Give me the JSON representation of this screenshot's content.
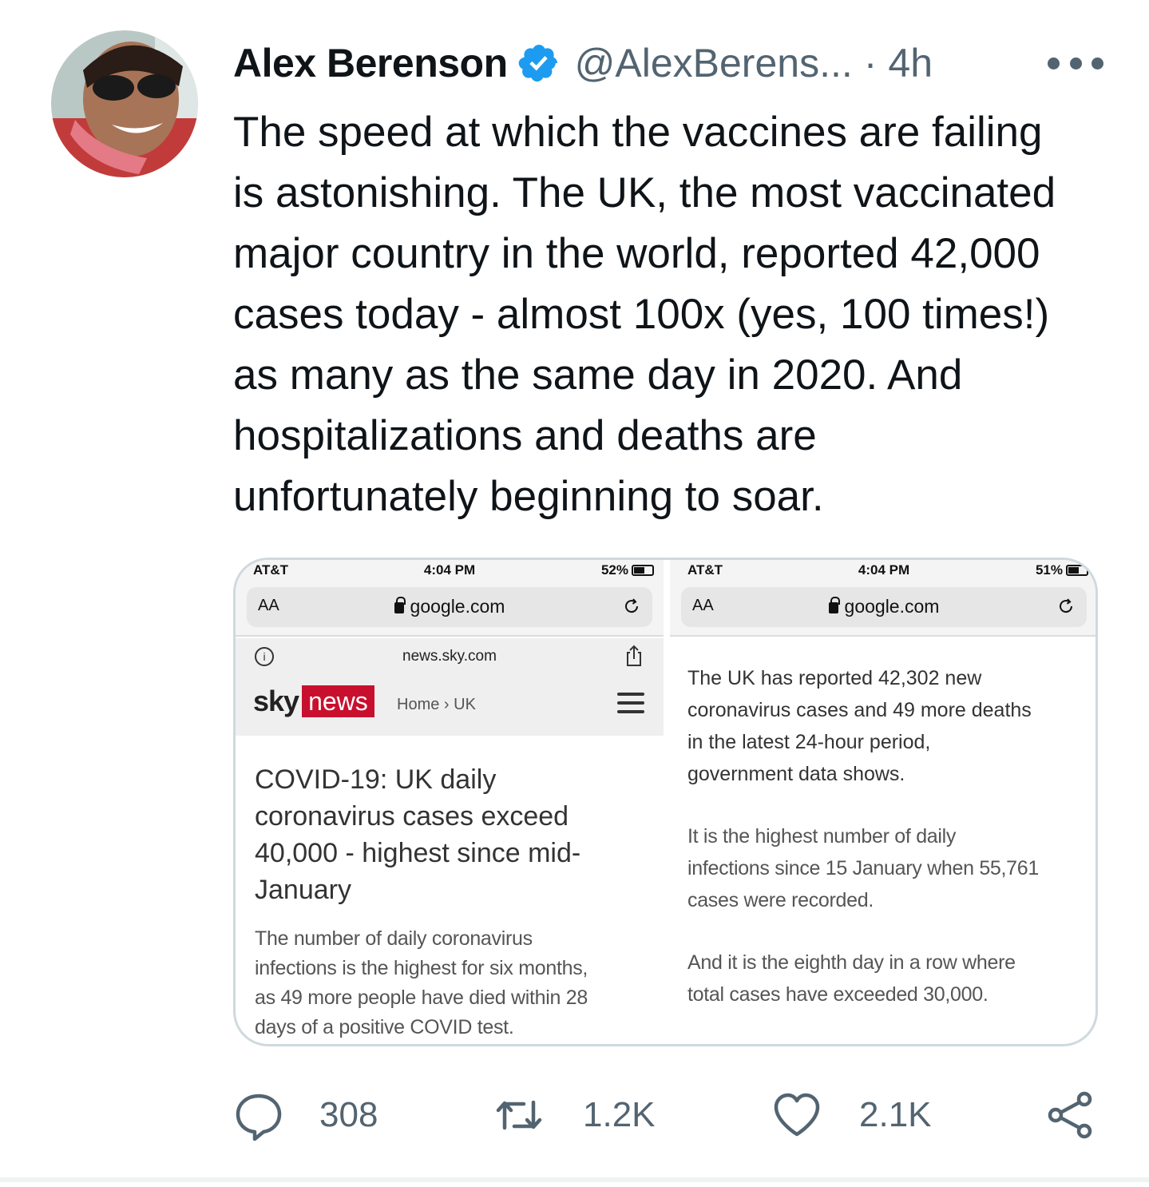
{
  "tweet": {
    "author_name": "Alex Berenson",
    "handle": "@AlexBerens...",
    "separator": "·",
    "time": "4h",
    "text_lines": [
      "The speed at which the vaccines are failing",
      "is astonishing. The UK, the most vaccinated",
      "major country in the world, reported 42,000",
      "cases today - almost 100x (yes, 100 times!)",
      "as many as the same day in 2020. And",
      "hospitalizations and deaths are",
      "unfortunately beginning to soar."
    ]
  },
  "media": {
    "left": {
      "status": {
        "carrier": "AT&T",
        "time": "4:04 PM",
        "battery": "52%"
      },
      "url_bar": {
        "aa": "AA",
        "url": "google.com"
      },
      "site_url": "news.sky.com",
      "logo": {
        "sky": "sky",
        "news": "news"
      },
      "breadcrumb": "Home › UK",
      "headline_lines": [
        "COVID-19: UK daily",
        "coronavirus cases exceed",
        "40,000 - highest since mid-",
        "January"
      ],
      "standfirst_lines": [
        "The number of daily coronavirus",
        "infections is the highest for six months,",
        "as 49 more people have died within 28",
        "days of a positive COVID test."
      ]
    },
    "right": {
      "status": {
        "carrier": "AT&T",
        "time": "4:04 PM",
        "battery": "51%"
      },
      "url_bar": {
        "aa": "AA",
        "url": "google.com"
      },
      "para1_lines": [
        "The UK has reported 42,302 new",
        "coronavirus cases and 49 more deaths",
        "in the latest 24-hour period,",
        "government data shows."
      ],
      "para2_lines": [
        "It is the highest number of daily",
        "infections since 15 January when 55,761",
        "cases were recorded."
      ],
      "para3_lines": [
        "And it is the eighth day in a row where",
        "total cases have exceeded 30,000."
      ]
    }
  },
  "actions": {
    "replies": "308",
    "retweets": "1.2K",
    "likes": "2.1K"
  },
  "icons": {
    "avatar": "avatar",
    "verified": "verified-badge-icon",
    "more": "more-options-icon",
    "reply": "reply-icon",
    "retweet": "retweet-icon",
    "like": "heart-icon",
    "share": "share-icon"
  },
  "colors": {
    "verified": "#1d9bf0",
    "secondary_text": "#536471",
    "sky_news_red": "#c8102e"
  }
}
